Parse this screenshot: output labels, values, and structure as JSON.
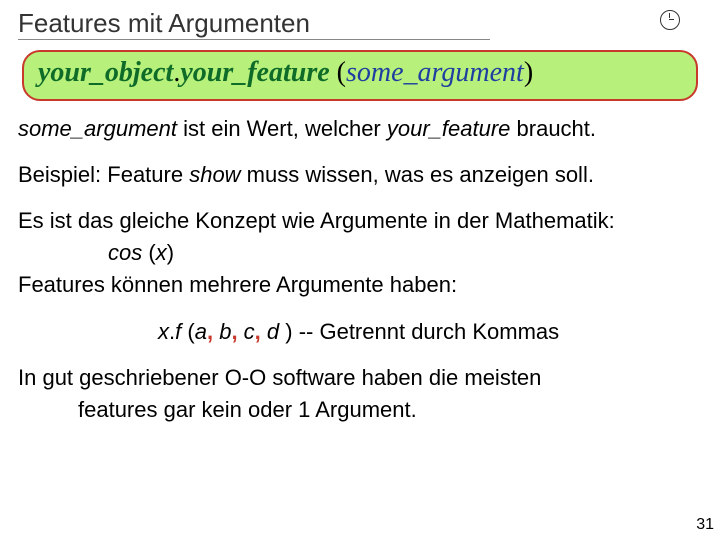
{
  "title": "Features mit Argumenten",
  "code": {
    "obj": "your_object",
    "dot": ".",
    "feat": "your_feature",
    "open": " (",
    "arg": "some_argument",
    "close": ")"
  },
  "line1": {
    "a": "some_argument",
    "b": " ist ein Wert, welcher ",
    "c": "your_feature",
    "d": " braucht."
  },
  "line2": {
    "a": "Beispiel: Feature ",
    "b": "show",
    "c": " muss wissen, was es anzeigen soll."
  },
  "line3": "Es ist das gleiche Konzept wie Argumente in der Mathematik:",
  "line3b": {
    "a": "cos",
    "b": " (",
    "c": "x",
    "d": ")"
  },
  "line4": "Features können mehrere Argumente haben:",
  "line5": {
    "x": "x",
    "dot": ".",
    "f": "f",
    "open": " (",
    "a": "a",
    "c1": ", ",
    "b": "b",
    "c2": ", ",
    "c": "c",
    "c3": ", ",
    "d": "d ",
    "close": ")",
    "comment": " --  Getrennt durch Kommas"
  },
  "line6a": "In gut geschriebener O-O software haben die meisten",
  "line6b": "features gar kein oder 1 Argument.",
  "pagenum": "31"
}
